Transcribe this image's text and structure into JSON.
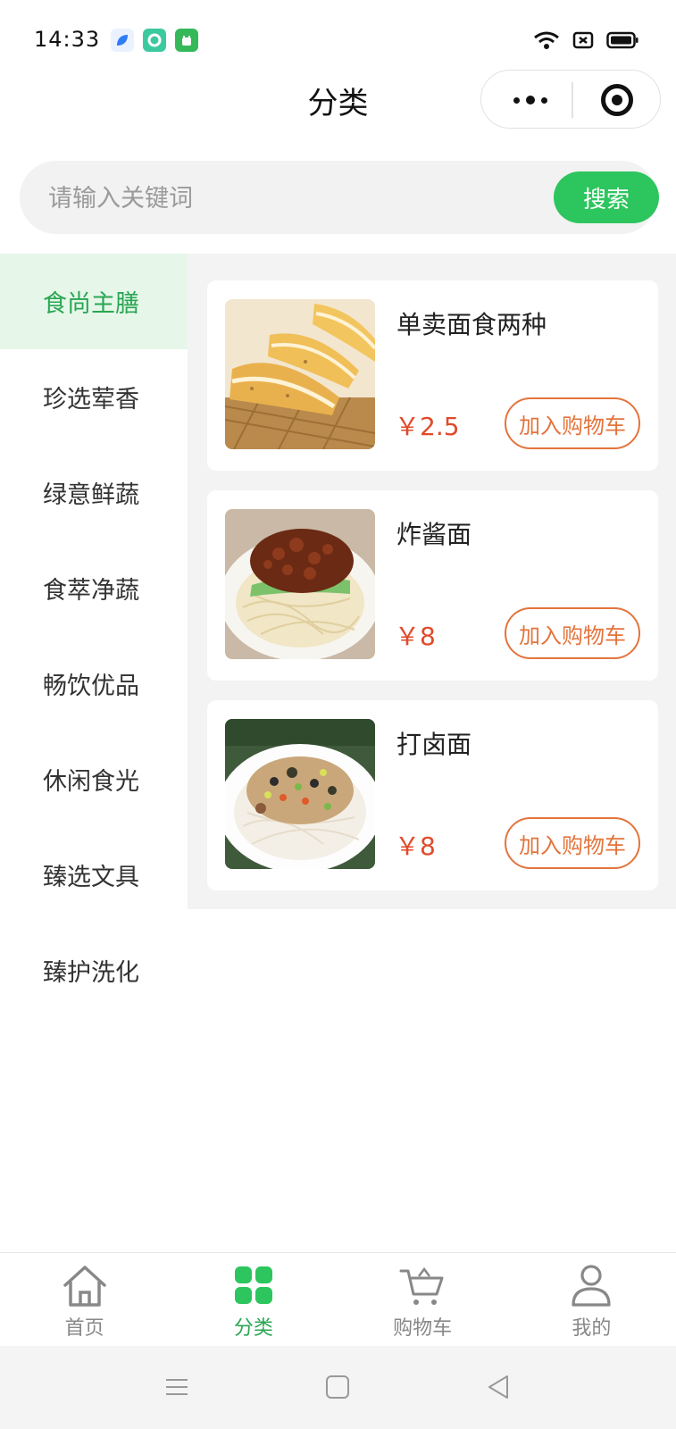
{
  "status_bar": {
    "time": "14:33"
  },
  "nav": {
    "title": "分类"
  },
  "search": {
    "placeholder": "请输入关键词",
    "button_label": "搜索"
  },
  "sidebar": {
    "items": [
      {
        "label": "食尚主膳",
        "active": true
      },
      {
        "label": "珍选荤香",
        "active": false
      },
      {
        "label": "绿意鲜蔬",
        "active": false
      },
      {
        "label": "食萃净蔬",
        "active": false
      },
      {
        "label": "畅饮优品",
        "active": false
      },
      {
        "label": "休闲食光",
        "active": false
      },
      {
        "label": "臻选文具",
        "active": false
      },
      {
        "label": "臻护洗化",
        "active": false
      }
    ]
  },
  "products": [
    {
      "name": "单卖面食两种",
      "price": "￥2.5",
      "button_label": "加入购物车"
    },
    {
      "name": "炸酱面",
      "price": "￥8",
      "button_label": "加入购物车"
    },
    {
      "name": "打卤面",
      "price": "￥8",
      "button_label": "加入购物车"
    }
  ],
  "tabbar": {
    "items": [
      {
        "label": "首页",
        "icon": "home-icon",
        "active": false
      },
      {
        "label": "分类",
        "icon": "category-icon",
        "active": true
      },
      {
        "label": "购物车",
        "icon": "cart-icon",
        "active": false
      },
      {
        "label": "我的",
        "icon": "user-icon",
        "active": false
      }
    ]
  },
  "colors": {
    "accent": "#2dc55e",
    "price": "#e04a2a",
    "cart_button": "#e3743c"
  }
}
